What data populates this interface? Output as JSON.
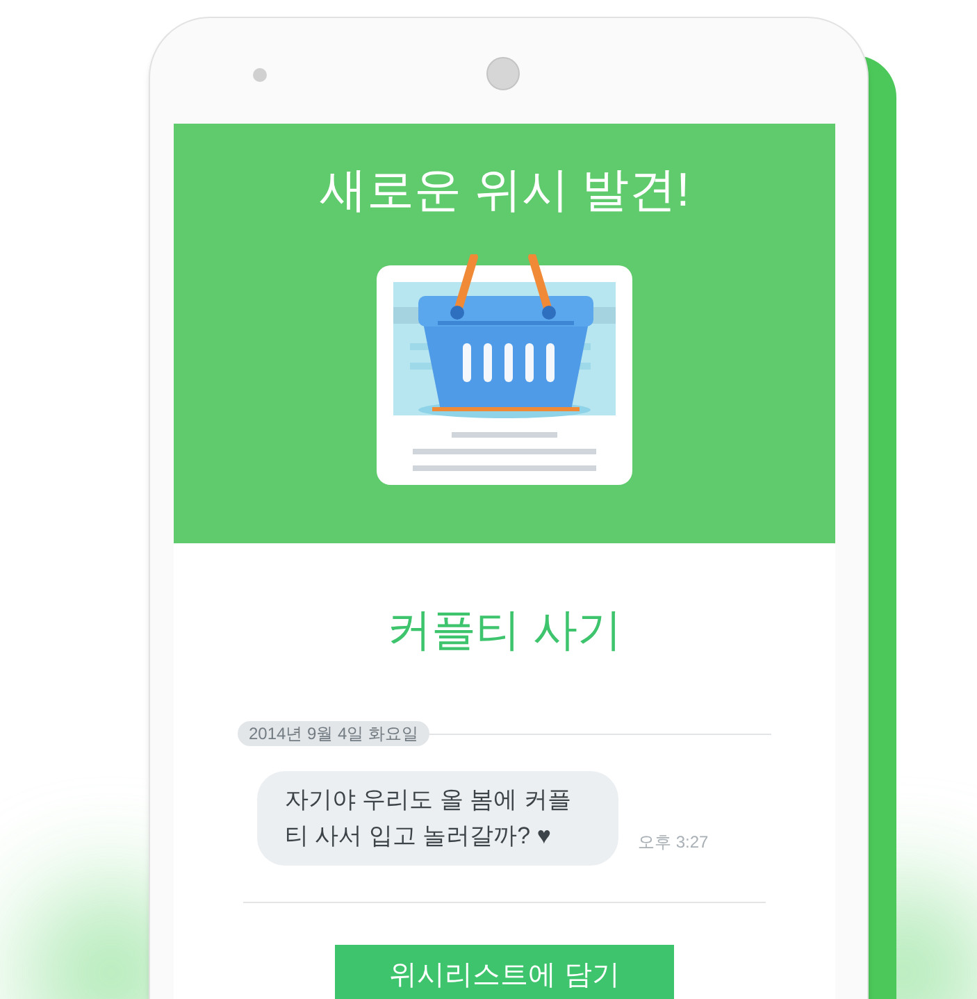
{
  "header": {
    "title": "새로운 위시 발견!"
  },
  "item": {
    "title": "커플티 사기"
  },
  "chat": {
    "date": "2014년 9월 4일 화요일",
    "message": "자기야 우리도 올 봄에 커플\n티 사서 입고 놀러갈까? ♥",
    "time": "오후 3:27"
  },
  "button": {
    "label": "위시리스트에 담기"
  }
}
